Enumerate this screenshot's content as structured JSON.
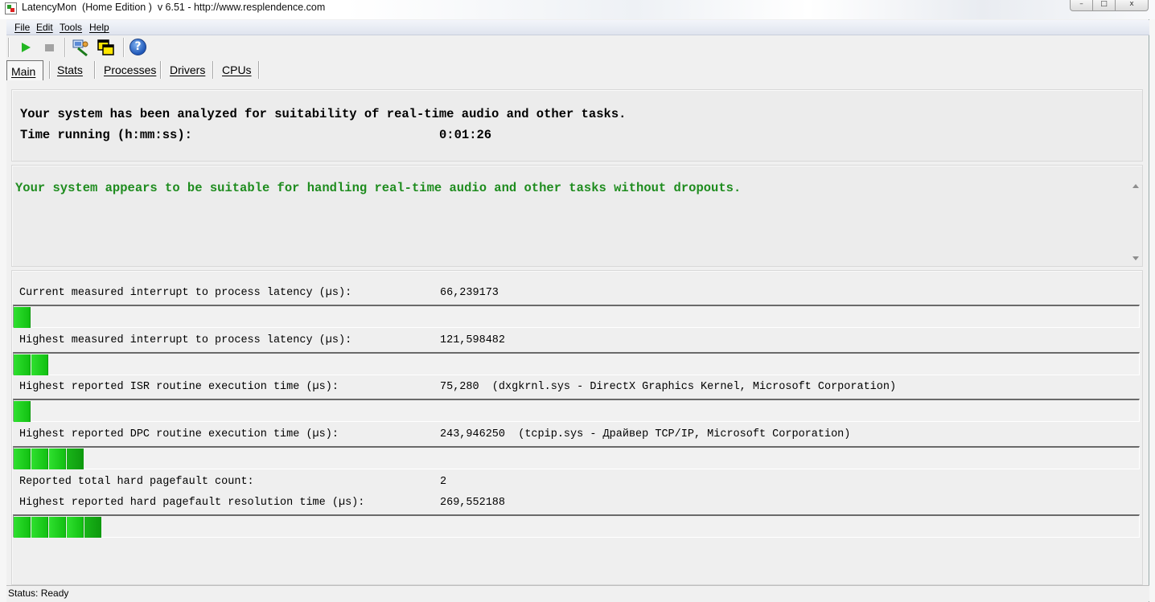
{
  "window": {
    "title": "LatencyMon  (Home Edition )  v 6.51 - http://www.resplendence.com",
    "minimize_glyph": "–",
    "maximize_glyph": "□",
    "close_glyph": "x"
  },
  "menu": [
    "File",
    "Edit",
    "Tools",
    "Help"
  ],
  "toolbar": {
    "icons": [
      "play-icon",
      "stop-icon",
      "system-info-icon",
      "copy-window-icon",
      "help-icon"
    ],
    "help_glyph": "?"
  },
  "tabs": [
    "Main",
    "Stats",
    "Processes",
    "Drivers",
    "CPUs"
  ],
  "active_tab": "Main",
  "summary": {
    "line1": "Your system has been analyzed for suitability of real-time audio and other tasks.",
    "time_label": "Time running (h:mm:ss):",
    "time_value": "0:01:26"
  },
  "verdict": {
    "text": "Your system appears to be suitable for handling real-time audio and other tasks without dropouts.",
    "color": "#1e8c1e"
  },
  "metrics": [
    {
      "label": "Current measured interrupt to process latency (µs):",
      "value": "66,239173",
      "bar_segments": 1
    },
    {
      "label": "Highest measured interrupt to process latency (µs):",
      "value": "121,598482",
      "bar_segments": 2
    },
    {
      "label": "Highest reported ISR routine execution time (µs):",
      "value": "75,280  (dxgkrnl.sys - DirectX Graphics Kernel, Microsoft Corporation)",
      "bar_segments": 1
    },
    {
      "label": "Highest reported DPC routine execution time (µs):",
      "value": "243,946250  (tcpip.sys - Драйвер TCP/IP, Microsoft Corporation)",
      "bar_segments": 4
    },
    {
      "label": "Reported total hard pagefault count:",
      "value": "2"
    },
    {
      "label": "Highest reported hard pagefault resolution time (µs):",
      "value": "269,552188",
      "bar_segments": 5
    }
  ],
  "colors": {
    "bar_green": "#22d022",
    "verdict_green": "#1e8c1e"
  },
  "status": "Status: Ready"
}
